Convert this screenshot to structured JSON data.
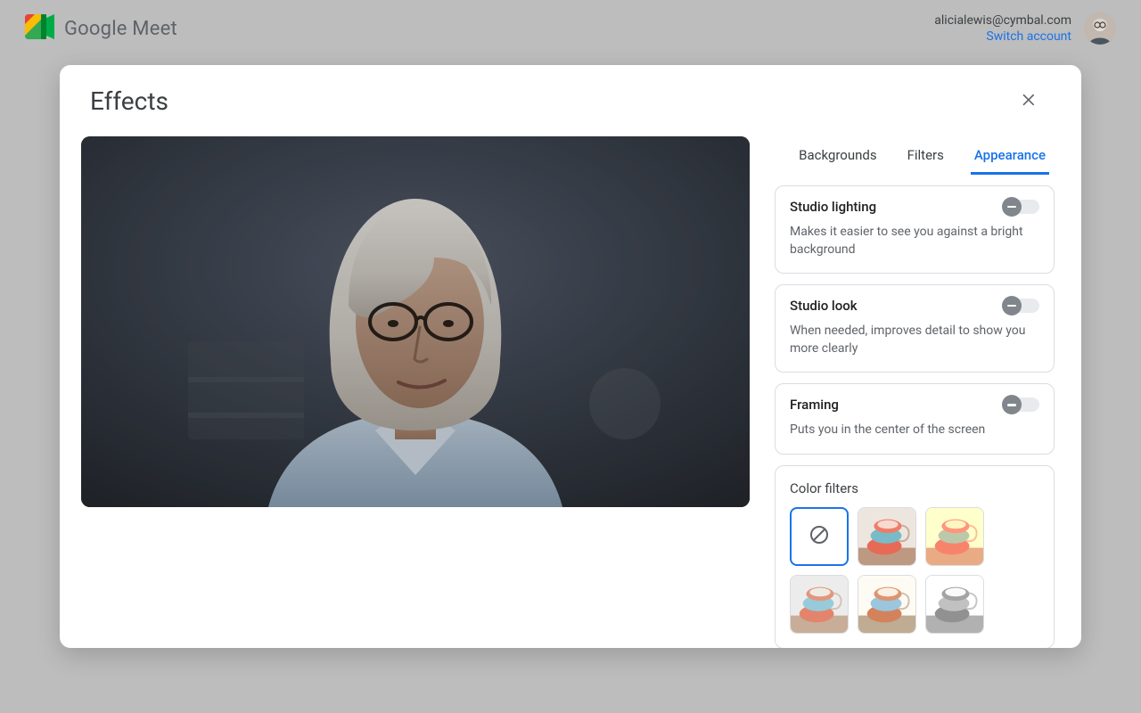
{
  "app": {
    "name": "Google Meet"
  },
  "account": {
    "email": "alicialewis@cymbal.com",
    "switch_label": "Switch account"
  },
  "modal": {
    "title": "Effects",
    "tabs": [
      {
        "id": "backgrounds",
        "label": "Backgrounds",
        "active": false
      },
      {
        "id": "filters",
        "label": "Filters",
        "active": false
      },
      {
        "id": "appearance",
        "label": "Appearance",
        "active": true
      }
    ],
    "settings": [
      {
        "id": "studio-lighting",
        "title": "Studio lighting",
        "desc": "Makes it easier to see you against a bright background",
        "on": false
      },
      {
        "id": "studio-look",
        "title": "Studio look",
        "desc": "When needed, improves detail to show you more clearly",
        "on": false
      },
      {
        "id": "framing",
        "title": "Framing",
        "desc": "Puts you in the center of the screen",
        "on": false
      }
    ],
    "color_filters": {
      "title": "Color filters",
      "options": [
        {
          "id": "none",
          "selected": true,
          "variant": "none"
        },
        {
          "id": "warm",
          "selected": false,
          "variant": "f-warm"
        },
        {
          "id": "peach",
          "selected": false,
          "variant": "f-peach"
        },
        {
          "id": "soft",
          "selected": false,
          "variant": "f-soft"
        },
        {
          "id": "cool",
          "selected": false,
          "variant": "f-cool"
        },
        {
          "id": "mono",
          "selected": false,
          "variant": "f-mono"
        }
      ]
    }
  },
  "colors": {
    "accent": "#1a73e8"
  }
}
